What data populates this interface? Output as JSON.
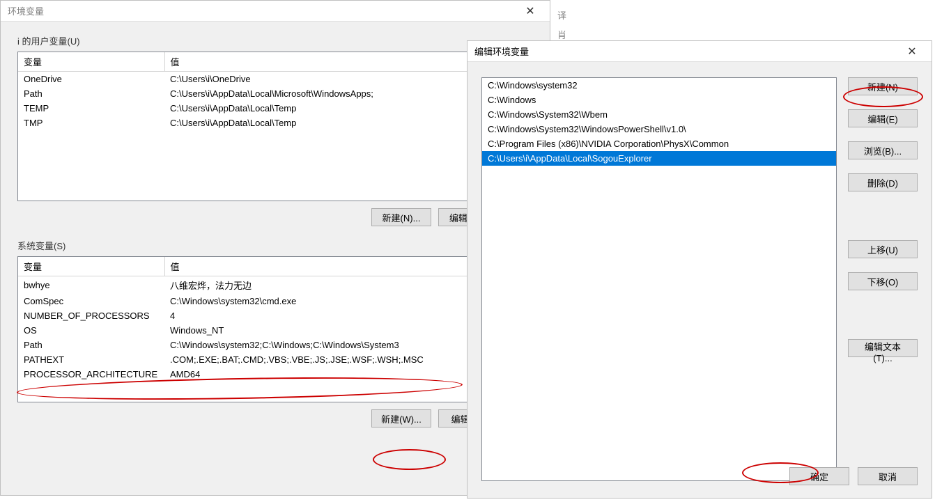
{
  "bg": {
    "frag1": "译",
    "frag2": "肖"
  },
  "env_dialog": {
    "title": "环境变量",
    "user_section_label": "i 的用户变量(U)",
    "system_section_label": "系统变量(S)",
    "headers": {
      "var": "变量",
      "val": "值"
    },
    "user_vars": [
      {
        "name": "OneDrive",
        "value": "C:\\Users\\i\\OneDrive"
      },
      {
        "name": "Path",
        "value": "C:\\Users\\i\\AppData\\Local\\Microsoft\\WindowsApps;"
      },
      {
        "name": "TEMP",
        "value": "C:\\Users\\i\\AppData\\Local\\Temp"
      },
      {
        "name": "TMP",
        "value": "C:\\Users\\i\\AppData\\Local\\Temp"
      }
    ],
    "system_vars": [
      {
        "name": "bwhye",
        "value": "八维宏烨，法力无边"
      },
      {
        "name": "ComSpec",
        "value": "C:\\Windows\\system32\\cmd.exe"
      },
      {
        "name": "NUMBER_OF_PROCESSORS",
        "value": "4"
      },
      {
        "name": "OS",
        "value": "Windows_NT"
      },
      {
        "name": "Path",
        "value": "C:\\Windows\\system32;C:\\Windows;C:\\Windows\\System3"
      },
      {
        "name": "PATHEXT",
        "value": ".COM;.EXE;.BAT;.CMD;.VBS;.VBE;.JS;.JSE;.WSF;.WSH;.MSC"
      },
      {
        "name": "PROCESSOR_ARCHITECTURE",
        "value": "AMD64"
      }
    ],
    "buttons": {
      "user_new": "新建(N)...",
      "user_edit": "编辑(E)...",
      "sys_new": "新建(W)...",
      "sys_edit": "编辑(I)..."
    }
  },
  "edit_dialog": {
    "title": "编辑环境变量",
    "paths": [
      "C:\\Windows\\system32",
      "C:\\Windows",
      "C:\\Windows\\System32\\Wbem",
      "C:\\Windows\\System32\\WindowsPowerShell\\v1.0\\",
      "C:\\Program Files (x86)\\NVIDIA Corporation\\PhysX\\Common",
      "C:\\Users\\i\\AppData\\Local\\SogouExplorer"
    ],
    "selected_index": 5,
    "buttons": {
      "new": "新建(N)",
      "edit": "编辑(E)",
      "browse": "浏览(B)...",
      "delete": "删除(D)",
      "move_up": "上移(U)",
      "move_down": "下移(O)",
      "edit_text": "编辑文本(T)...",
      "ok": "确定",
      "cancel": "取消"
    }
  }
}
